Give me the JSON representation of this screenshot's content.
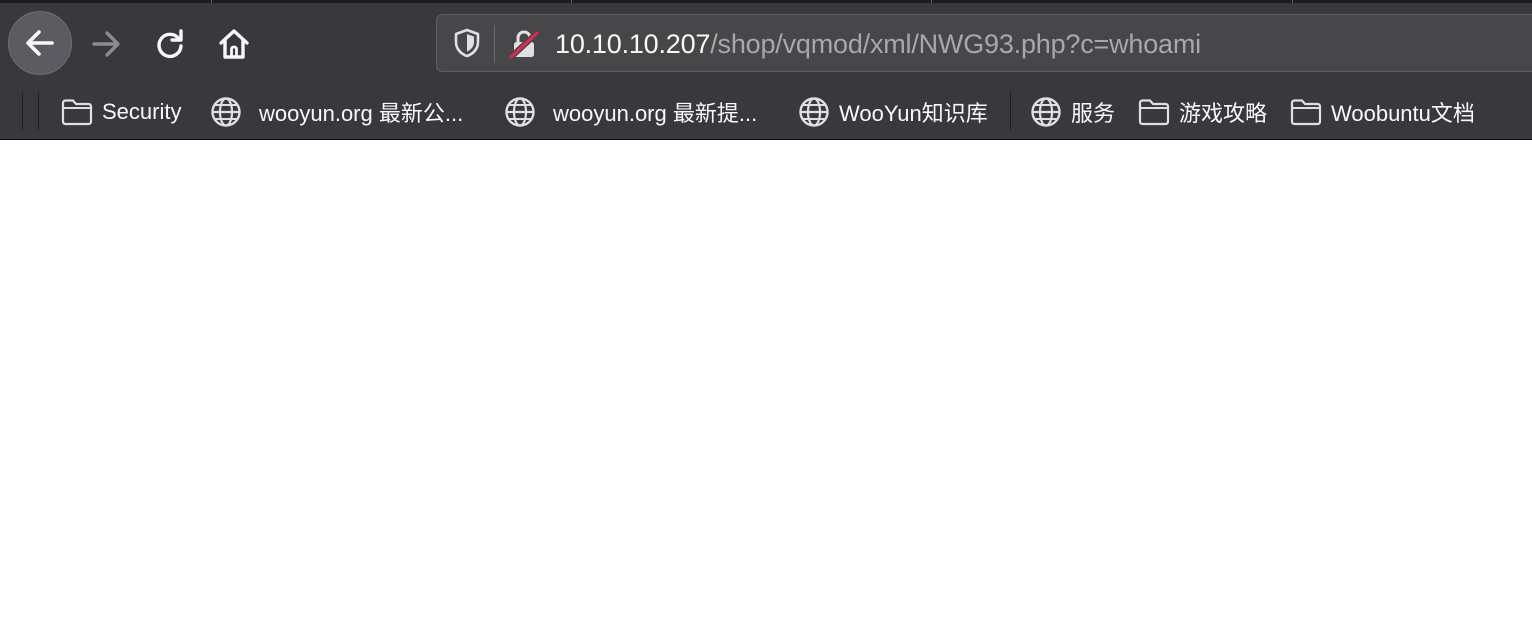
{
  "toolbar": {
    "back_icon": "arrow-left-icon",
    "forward_icon": "arrow-right-icon",
    "reload_icon": "reload-icon",
    "home_icon": "home-icon"
  },
  "urlbar": {
    "host": "10.10.10.207",
    "path": "/shop/vqmod/xml/NWG93.php?c=whoami",
    "tracking_icon": "shield-icon",
    "security_icon": "insecure-lock-icon"
  },
  "bookmarks": [
    {
      "label": "Security",
      "icon": "folder-icon"
    },
    {
      "label": "wooyun.org 最新公...",
      "icon": "globe-icon"
    },
    {
      "label": "wooyun.org 最新提...",
      "icon": "globe-icon"
    },
    {
      "label": "WooYun知识库",
      "icon": "globe-icon"
    },
    {
      "label": "服务",
      "icon": "globe-icon"
    },
    {
      "label": "游戏攻略",
      "icon": "folder-icon"
    },
    {
      "label": "Woobuntu文档",
      "icon": "folder-icon"
    }
  ],
  "colors": {
    "toolbar_bg": "#38383d",
    "urlbar_bg": "#474749",
    "insecure_strike": "#e22850",
    "page_bg": "#ffffff"
  }
}
